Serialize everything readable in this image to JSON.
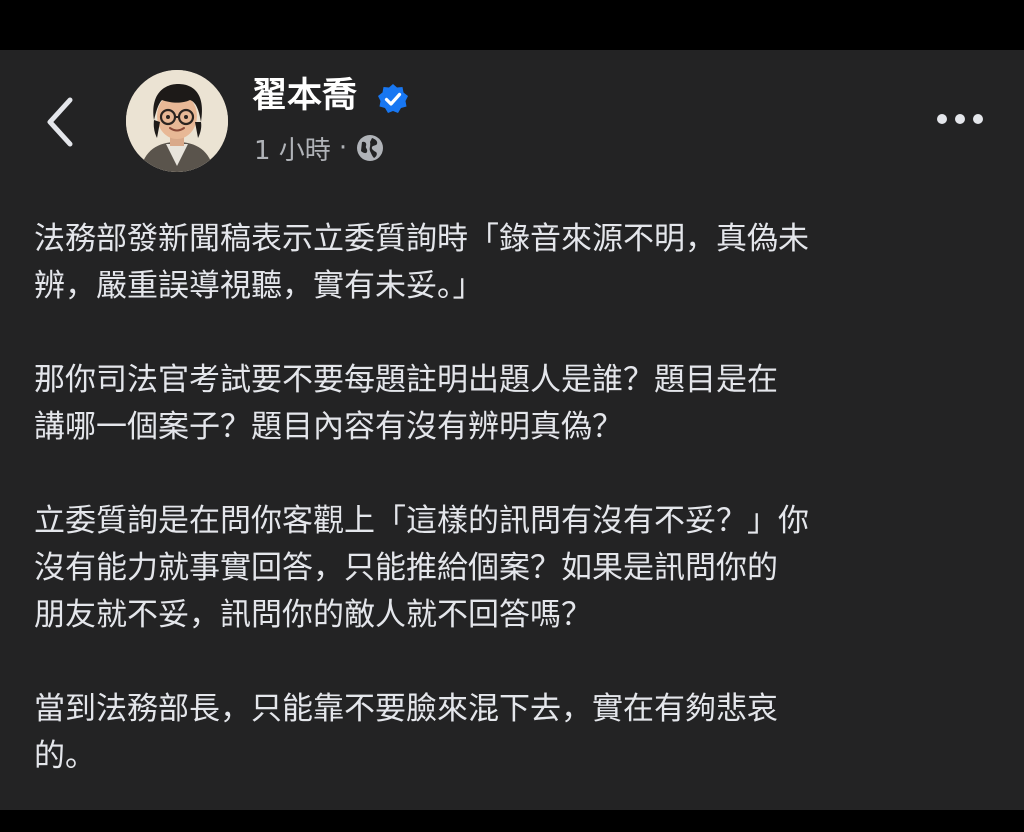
{
  "post": {
    "author": "翟本喬",
    "time": "1 小時",
    "separator": "·",
    "verified_icon": "verified-badge-icon",
    "audience_icon": "globe-icon",
    "paragraphs": [
      "法務部發新聞稿表示立委質詢時「錄音來源不明，真偽未\n辨，嚴重誤導視聽，實有未妥。」",
      "那你司法官考試要不要每題註明出題人是誰？題目是在\n講哪一個案子？題目內容有沒有辨明真偽？",
      "立委質詢是在問你客觀上「這樣的訊問有沒有不妥？」你\n沒有能力就事實回答，只能推給個案？如果是訊問你的\n朋友就不妥，訊問你的敵人就不回答嗎？",
      "當到法務部長，只能靠不要臉來混下去，實在有夠悲哀\n的。"
    ]
  },
  "colors": {
    "background": "#232324",
    "frame": "#000000",
    "text": "#e4e6eb",
    "muted": "#b0b3b8",
    "verified": "#1877f2"
  }
}
